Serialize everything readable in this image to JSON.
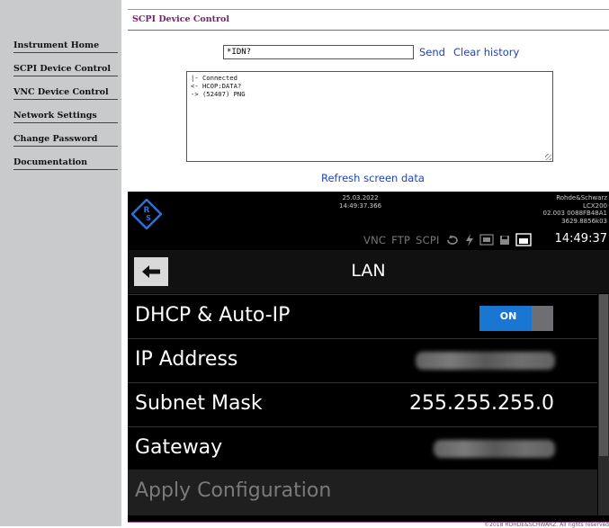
{
  "sidebar": {
    "items": [
      {
        "label": "Instrument Home"
      },
      {
        "label": "SCPI Device Control"
      },
      {
        "label": "VNC Device Control"
      },
      {
        "label": "Network Settings"
      },
      {
        "label": "Change Password"
      },
      {
        "label": "Documentation"
      }
    ]
  },
  "page": {
    "title": "SCPI Device Control"
  },
  "scpi": {
    "command_value": "*IDN?",
    "send_label": "Send",
    "clear_label": "Clear history",
    "console_lines": [
      "|- Connected",
      "<- HCOP:DATA?",
      "-> (52407) PNG"
    ],
    "refresh_label": "Refresh screen data"
  },
  "device": {
    "date": "25.03.2022",
    "time_full": "14:49:37.366",
    "info_lines": [
      "Rohde&Schwarz",
      "LCX200",
      "02.003 0088FB48A1",
      "3629.8856k03"
    ],
    "status": {
      "vnc": "VNC",
      "ftp": "FTP",
      "scpi": "SCPI",
      "clock": "14:49:37",
      "icons": [
        "refresh-icon",
        "lightning-icon",
        "usb-drive-icon",
        "floppy-icon",
        "network-icon"
      ]
    },
    "screen_title": "LAN",
    "rows": [
      {
        "label": "DHCP & Auto-IP",
        "toggle": "ON"
      },
      {
        "label": "IP Address",
        "value_hidden": true
      },
      {
        "label": "Subnet Mask",
        "value": "255.255.255.0"
      },
      {
        "label": "Gateway",
        "value_hidden": true
      }
    ],
    "apply_label": "Apply Configuration",
    "colors": {
      "toggle_on": "#1976d2",
      "accent": "#7a1f6e"
    }
  },
  "footer": {
    "copyright": "©2018 ROHDE&SCHWARZ. All rights reserved"
  }
}
